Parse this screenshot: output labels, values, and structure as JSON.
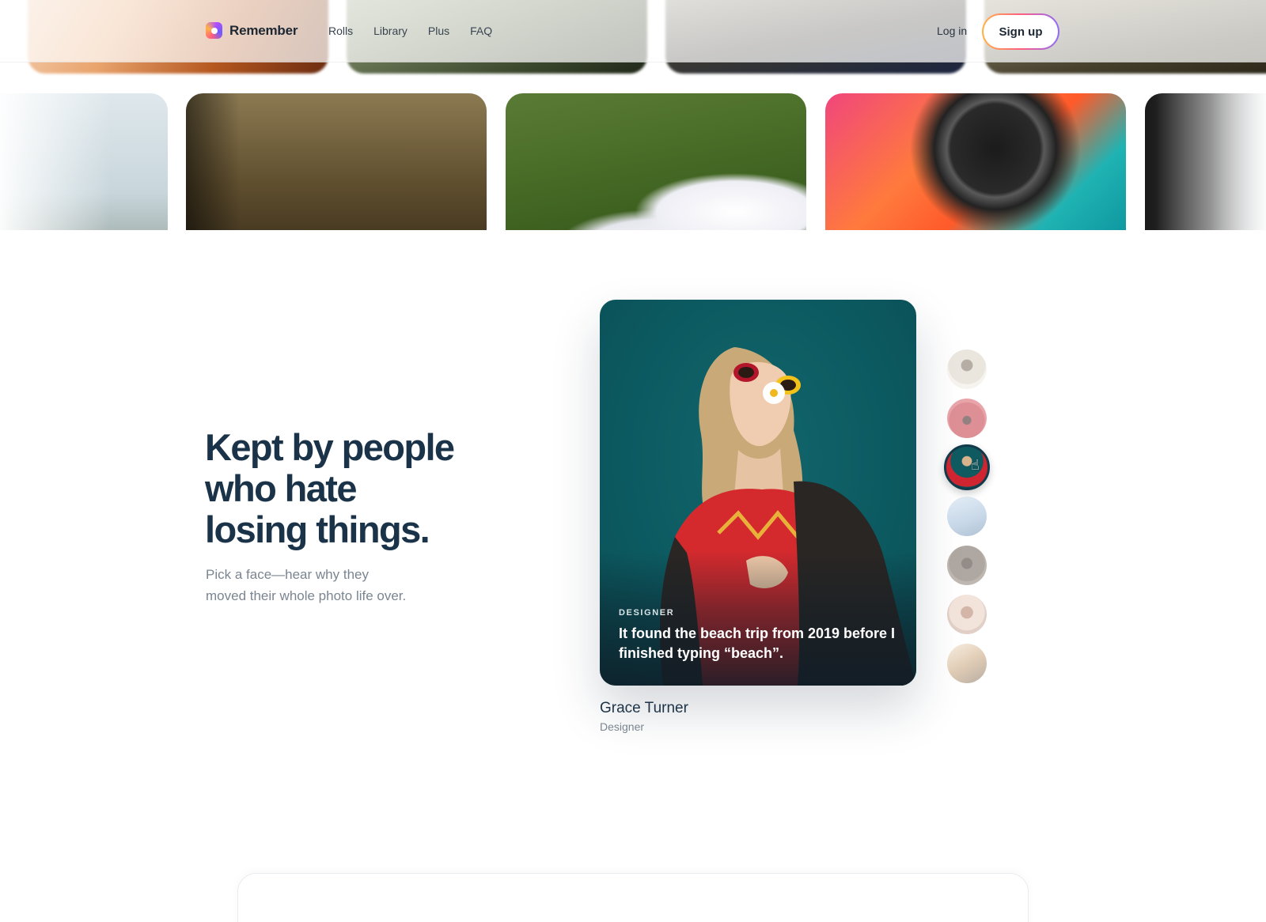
{
  "header": {
    "brand": "Remember",
    "nav": [
      "Rolls",
      "Library",
      "Plus",
      "FAQ"
    ],
    "login": "Log in",
    "signup": "Sign up"
  },
  "section": {
    "headline_lines": [
      "Kept by people",
      "who hate",
      "losing things."
    ],
    "subline_lines": [
      "Pick a face—hear why they",
      "moved their whole photo life over."
    ]
  },
  "card": {
    "role_label": "DESIGNER",
    "quote": "It found the beach trip from 2019 before I finished typing “beach”."
  },
  "person": {
    "name": "Grace Turner",
    "role": "Designer"
  },
  "faces": {
    "count": 7,
    "active_index": 3
  },
  "colors": {
    "heading": "#1a3349",
    "card_bg": "#0c5960",
    "accent_gradient": [
      "#ffb347",
      "#ff5f7e",
      "#8e6bff"
    ]
  }
}
